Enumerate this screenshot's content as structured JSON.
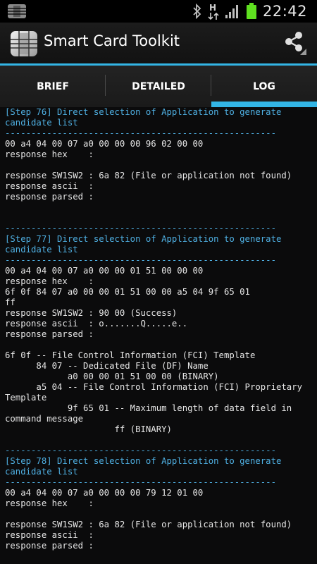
{
  "status_bar": {
    "time": "22:42",
    "network_label": "H",
    "icons": [
      "app-notification-icon",
      "bluetooth-icon",
      "network-h-icon",
      "signal-icon",
      "battery-icon"
    ],
    "battery_color": "#5fe020"
  },
  "action_bar": {
    "title": "Smart Card Toolkit",
    "share_icon": "share-icon",
    "accent": "#33b5e5"
  },
  "tabs": [
    {
      "label": "BRIEF",
      "active": false
    },
    {
      "label": "DETAILED",
      "active": false
    },
    {
      "label": "LOG",
      "active": true
    }
  ],
  "log": {
    "lines": [
      {
        "text": "[Step 76] Direct selection of Application to generate",
        "color": "blue"
      },
      {
        "text": "candidate list",
        "color": "blue"
      },
      {
        "text": "----------------------------------------------------",
        "color": "blue"
      },
      {
        "text": "00 a4 04 00 07 a0 00 00 00 96 02 00 00",
        "color": "white"
      },
      {
        "text": "response hex    :",
        "color": "white"
      },
      {
        "text": "",
        "color": "white"
      },
      {
        "text": "response SW1SW2 : 6a 82 (File or application not found)",
        "color": "white"
      },
      {
        "text": "response ascii  :",
        "color": "white"
      },
      {
        "text": "response parsed :",
        "color": "white"
      },
      {
        "text": "",
        "color": "white"
      },
      {
        "text": "",
        "color": "white"
      },
      {
        "text": "----------------------------------------------------",
        "color": "blue"
      },
      {
        "text": "[Step 77] Direct selection of Application to generate",
        "color": "blue"
      },
      {
        "text": "candidate list",
        "color": "blue"
      },
      {
        "text": "----------------------------------------------------",
        "color": "blue"
      },
      {
        "text": "00 a4 04 00 07 a0 00 00 01 51 00 00 00",
        "color": "white"
      },
      {
        "text": "response hex    :",
        "color": "white"
      },
      {
        "text": "6f 0f 84 07 a0 00 00 01 51 00 00 a5 04 9f 65 01",
        "color": "white"
      },
      {
        "text": "ff",
        "color": "white"
      },
      {
        "text": "response SW1SW2 : 90 00 (Success)",
        "color": "white"
      },
      {
        "text": "response ascii  : o.......Q.....e..",
        "color": "white"
      },
      {
        "text": "response parsed :",
        "color": "white"
      },
      {
        "text": "",
        "color": "white"
      },
      {
        "text": "6f 0f -- File Control Information (FCI) Template",
        "color": "white"
      },
      {
        "text": "      84 07 -- Dedicated File (DF) Name",
        "color": "white"
      },
      {
        "text": "            a0 00 00 01 51 00 00 (BINARY)",
        "color": "white"
      },
      {
        "text": "      a5 04 -- File Control Information (FCI) Proprietary",
        "color": "white"
      },
      {
        "text": "Template",
        "color": "white"
      },
      {
        "text": "            9f 65 01 -- Maximum length of data field in",
        "color": "white"
      },
      {
        "text": "command message",
        "color": "white"
      },
      {
        "text": "                     ff (BINARY)",
        "color": "white"
      },
      {
        "text": "",
        "color": "white"
      },
      {
        "text": "----------------------------------------------------",
        "color": "blue"
      },
      {
        "text": "[Step 78] Direct selection of Application to generate",
        "color": "blue"
      },
      {
        "text": "candidate list",
        "color": "blue"
      },
      {
        "text": "----------------------------------------------------",
        "color": "blue"
      },
      {
        "text": "00 a4 04 00 07 a0 00 00 00 79 12 01 00",
        "color": "white"
      },
      {
        "text": "response hex    :",
        "color": "white"
      },
      {
        "text": "",
        "color": "white"
      },
      {
        "text": "response SW1SW2 : 6a 82 (File or application not found)",
        "color": "white"
      },
      {
        "text": "response ascii  :",
        "color": "white"
      },
      {
        "text": "response parsed :",
        "color": "white"
      }
    ]
  }
}
